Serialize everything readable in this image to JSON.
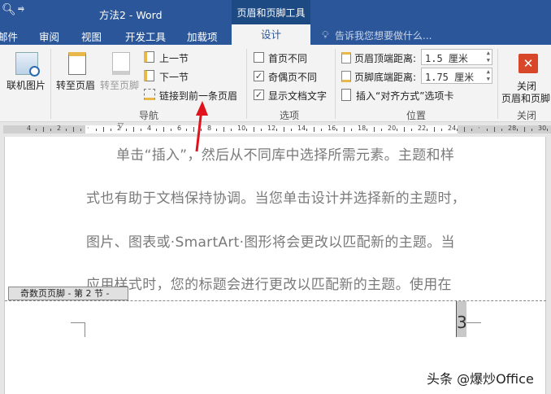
{
  "title_bar": {
    "title": "方法2 - Word",
    "contextual_tab": "页眉和页脚工具",
    "search_icon": "search-icon",
    "qat_icon": "customize-qat-icon"
  },
  "tabs": [
    {
      "label": "邮件"
    },
    {
      "label": "审阅"
    },
    {
      "label": "视图"
    },
    {
      "label": "开发工具"
    },
    {
      "label": "加载项"
    },
    {
      "label": "设计",
      "active": true
    }
  ],
  "tell_me": {
    "placeholder": "告诉我您想要做什么..."
  },
  "ribbon": {
    "insert": {
      "online_pictures": "联机图片"
    },
    "navigation": {
      "label": "导航",
      "goto_header": "转至页眉",
      "goto_footer": "转至页脚",
      "prev_section": "上一节",
      "next_section": "下一节",
      "link_previous": "链接到前一条页眉"
    },
    "options": {
      "label": "选项",
      "different_first": {
        "label": "首页不同",
        "checked": false
      },
      "different_odd_even": {
        "label": "奇偶页不同",
        "checked": true
      },
      "show_doc_text": {
        "label": "显示文档文字",
        "checked": true
      }
    },
    "position": {
      "label": "位置",
      "header_top_label": "页眉顶端距离:",
      "header_top_value": "1.5 厘米",
      "footer_bottom_label": "页脚底端距离:",
      "footer_bottom_value": "1.75 厘米",
      "insert_align_tab": "插入“对齐方式”选项卡"
    },
    "close": {
      "label": "关闭",
      "button": "关闭\n页眉和页脚",
      "button_line1": "关闭",
      "button_line2": "页眉和页脚"
    }
  },
  "ruler": {
    "ticks": [
      "4",
      "2",
      "",
      "2",
      "4",
      "6",
      "8",
      "10",
      "12",
      "14",
      "16",
      "18",
      "20",
      "22",
      "24",
      "",
      "28",
      "30"
    ]
  },
  "document": {
    "lines": [
      "单击“插入”，然后从不同库中选择所需元素。主题和样",
      "式也有助于文档保持协调。当您单击设计并选择新的主题时，",
      "图片、图表或·SmartArt·图形将会更改以匹配新的主题。当",
      "应用样式时，您的标题会进行更改以匹配新的主题。使用在"
    ],
    "footer_tab": "奇数页页脚 - 第 2 节 -",
    "page_number": "3"
  },
  "watermark": "头条 @爆炒Office",
  "colors": {
    "accent": "#2b579a",
    "arrow": "#e0121b",
    "close": "#d9472b"
  }
}
